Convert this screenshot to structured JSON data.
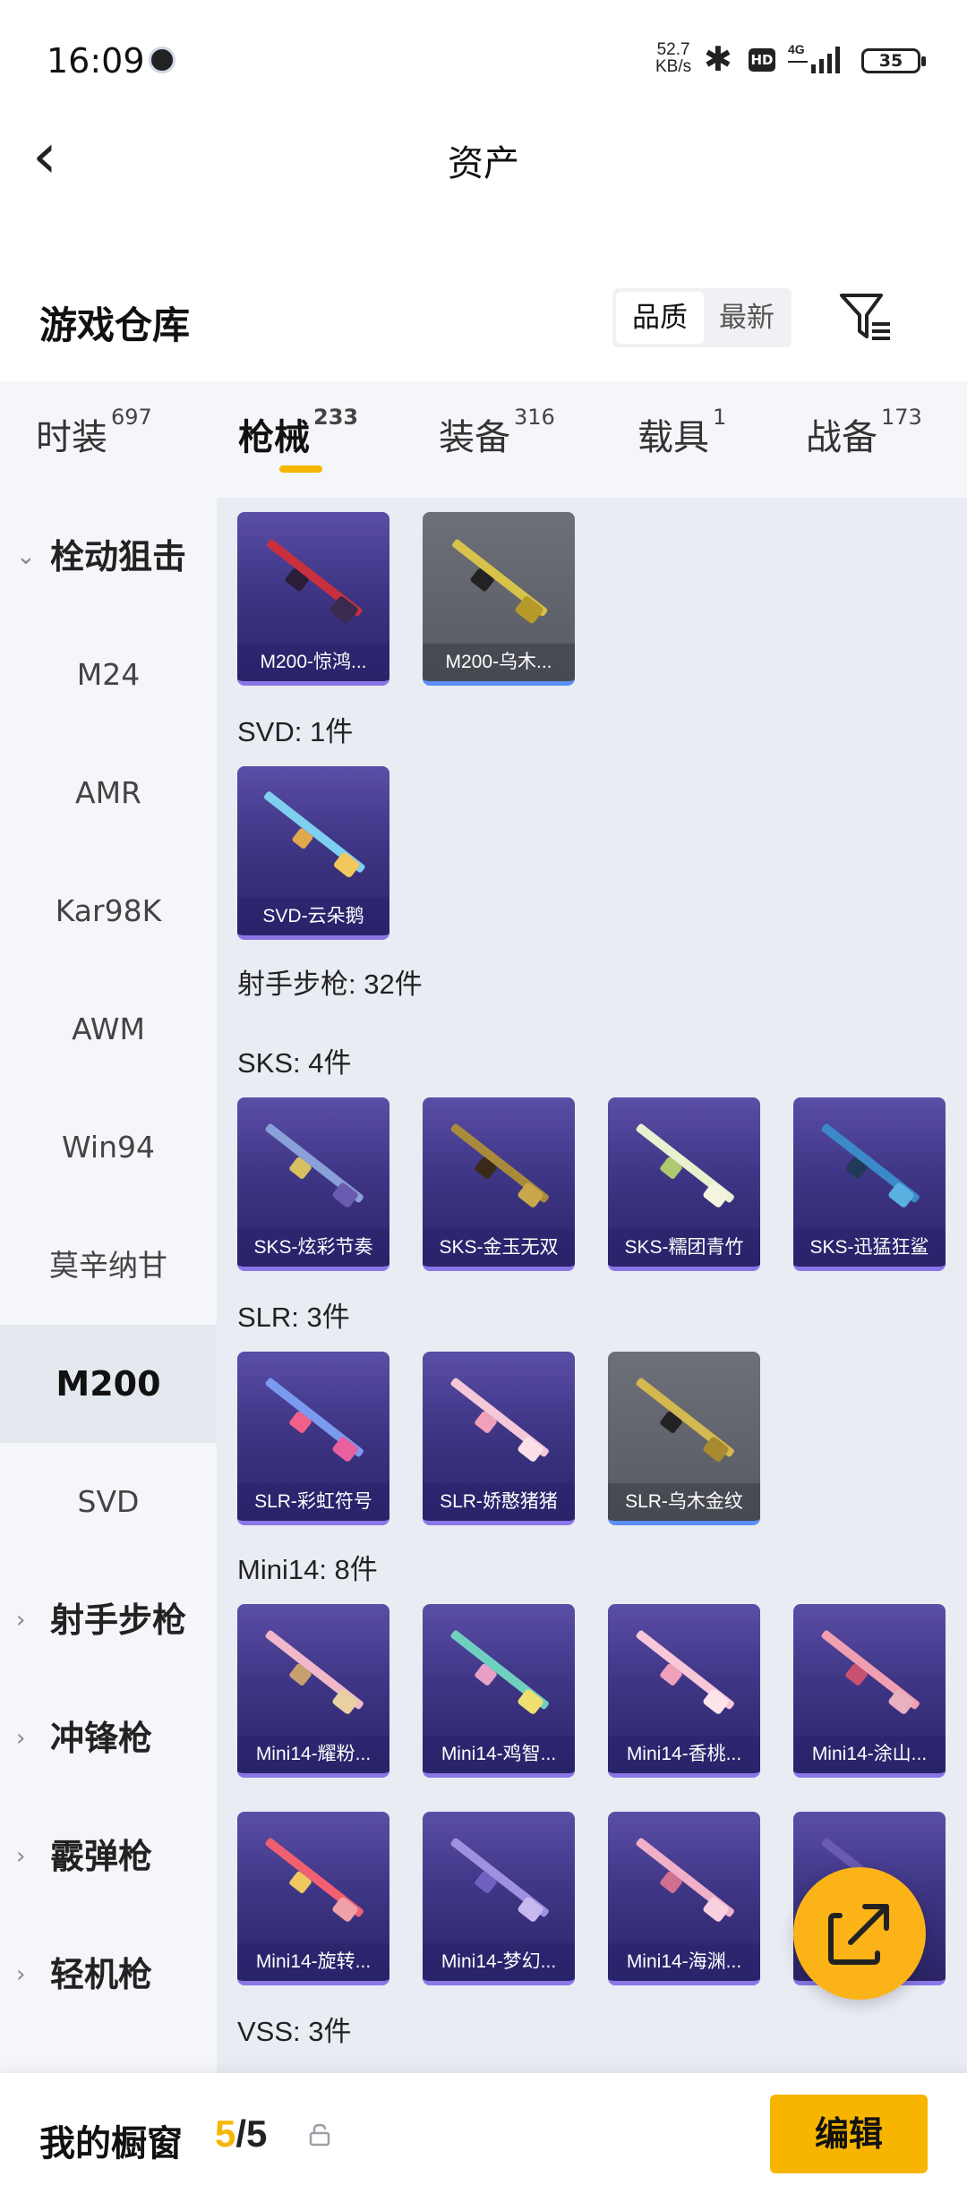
{
  "status_bar": {
    "time": "16:09",
    "net_speed_value": "52.7",
    "net_speed_unit": "KB/s",
    "hd": "HD",
    "network": "4G",
    "battery": "35"
  },
  "header": {
    "title": "资产"
  },
  "section": {
    "title": "游戏仓库",
    "sort_quality": "品质",
    "sort_newest": "最新"
  },
  "tabs": [
    {
      "label": "时装",
      "count": "697"
    },
    {
      "label": "枪械",
      "count": "233"
    },
    {
      "label": "装备",
      "count": "316"
    },
    {
      "label": "载具",
      "count": "1"
    },
    {
      "label": "战备",
      "count": "173"
    }
  ],
  "sidebar": {
    "group_bolt": "栓动狙击",
    "items": [
      "M24",
      "AMR",
      "Kar98K",
      "AWM",
      "Win94",
      "莫辛纳甘",
      "M200",
      "SVD"
    ],
    "groups": [
      "射手步枪",
      "冲锋枪",
      "霰弹枪",
      "轻机枪"
    ]
  },
  "sections": {
    "svd": "SVD: 1件",
    "dmr": "射手步枪: 32件",
    "sks": "SKS: 4件",
    "slr": "SLR: 3件",
    "mini14": "Mini14: 8件",
    "vss": "VSS: 3件"
  },
  "cards": {
    "m200": [
      "M200-惊鸿...",
      "M200-乌木..."
    ],
    "svd": [
      "SVD-云朵鹅"
    ],
    "sks": [
      "SKS-炫彩节奏",
      "SKS-金玉无双",
      "SKS-糯团青竹",
      "SKS-迅猛狂鲨"
    ],
    "slr": [
      "SLR-彩虹符号",
      "SLR-娇憨猪猪",
      "SLR-乌木金纹"
    ],
    "mini14_a": [
      "Mini14-耀粉...",
      "Mini14-鸡智...",
      "Mini14-香桃...",
      "Mini14-涂山..."
    ],
    "mini14_b": [
      "Mini14-旋转...",
      "Mini14-梦幻...",
      "Mini14-海渊..."
    ]
  },
  "footer": {
    "label": "我的橱窗",
    "current": "5",
    "separator": "/",
    "total": "5",
    "edit": "编辑"
  },
  "colors": {
    "accent": "#f7b500",
    "card_purple": "#3f3686",
    "card_grey": "#5e6068",
    "fab": "#fbb317"
  }
}
